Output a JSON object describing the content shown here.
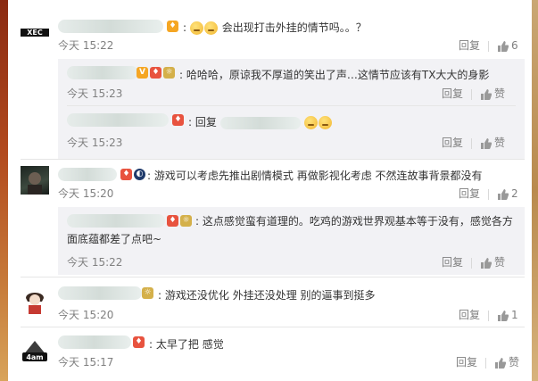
{
  "comments": [
    {
      "text": "会出现打击外挂的情节吗。。？",
      "time": "今天 15:22",
      "reply_label": "回复",
      "like_count": "6",
      "avatar_text": "XEC",
      "replies": [
        {
          "text": "哈哈哈，原谅我不厚道的笑出了声…这情节应该有TX大大的身影",
          "time": "今天 15:23",
          "reply_label": "回复",
          "like_label": "赞"
        },
        {
          "text": "回复",
          "time": "今天 15:23",
          "reply_label": "回复",
          "like_label": "赞"
        }
      ]
    },
    {
      "text": "游戏可以考虑先推出剧情模式 再做影视化考虑 不然连故事背景都没有",
      "time": "今天 15:20",
      "reply_label": "回复",
      "like_count": "2",
      "replies": [
        {
          "text": "这点感觉蛮有道理的。吃鸡的游戏世界观基本等于没有，感觉各方面底蕴都差了点吧~",
          "time": "今天 15:22",
          "reply_label": "回复",
          "like_label": "赞"
        }
      ]
    },
    {
      "text": "游戏还没优化 外挂还没处理 别的逼事到挺多",
      "time": "今天 15:20",
      "reply_label": "回复",
      "like_count": "1"
    },
    {
      "text": "太早了把 感觉",
      "time": "今天 15:17",
      "reply_label": "回复",
      "like_label": "赞",
      "avatar_text": "4am"
    }
  ],
  "colors": {
    "reply_bg": "#f2f2f5",
    "muted": "#808080",
    "text": "#333333"
  }
}
